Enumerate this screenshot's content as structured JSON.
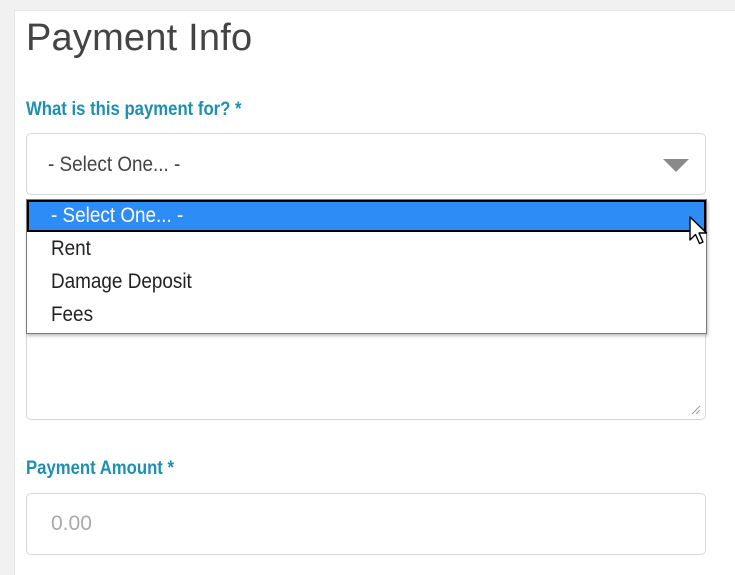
{
  "section": {
    "title": "Payment Info"
  },
  "payment_for": {
    "label": "What is this payment for? *",
    "selected_value": "- Select One... -",
    "options": [
      "- Select One... -",
      "Rent",
      "Damage Deposit",
      "Fees"
    ],
    "highlighted_index": 0
  },
  "payment_amount": {
    "label": "Payment Amount *",
    "placeholder": "0.00",
    "value": ""
  },
  "colors": {
    "label_accent": "#1f8fb0",
    "highlight": "#2e8cf7",
    "title_text": "#444444"
  }
}
